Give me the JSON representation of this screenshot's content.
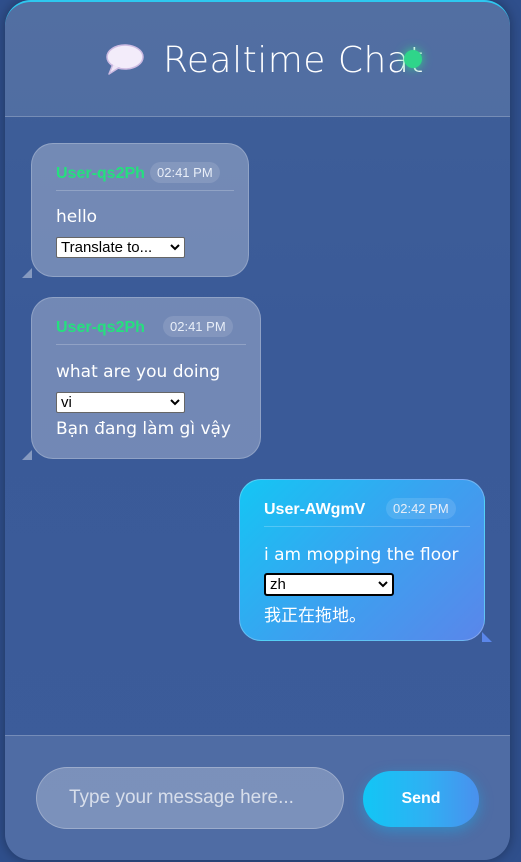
{
  "header": {
    "title": "Realtime Chat",
    "emoji_icon": "speech-balloon-icon",
    "status": "online",
    "status_color": "#2fd58a"
  },
  "messages": [
    {
      "user": "User-qs2Ph",
      "time": "02:41 PM",
      "text": "hello",
      "language": "Translate to...",
      "translation": "",
      "direction": "incoming"
    },
    {
      "user": "User-qs2Ph",
      "time": "02:41 PM",
      "text": "what are you doing",
      "language": "vi",
      "translation": "Bạn đang làm gì vậy",
      "direction": "incoming"
    },
    {
      "user": "User-AWgmV",
      "time": "02:42 PM",
      "text": "i am mopping the floor",
      "language": "zh",
      "translation": "我正在拖地。",
      "direction": "outgoing"
    }
  ],
  "composer": {
    "placeholder": "Type your message here...",
    "send_label": "Send"
  },
  "colors": {
    "accent": "#14c6f4",
    "username_incoming": "#25e07e",
    "background": "#2f4f8c"
  }
}
